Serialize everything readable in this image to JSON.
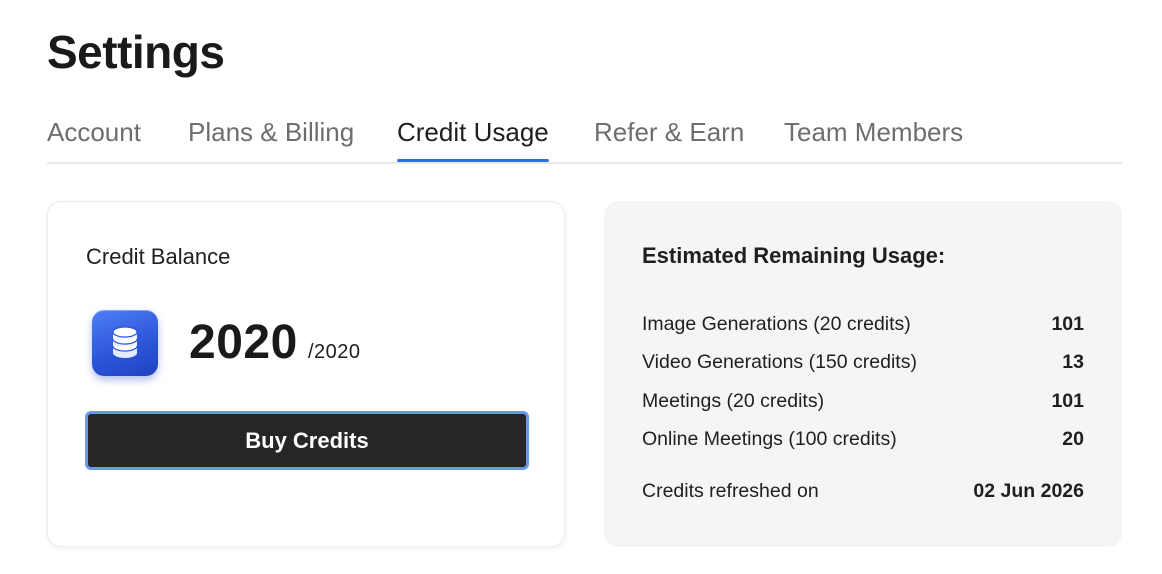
{
  "page": {
    "title": "Settings"
  },
  "tabs": [
    {
      "label": "Account",
      "active": false
    },
    {
      "label": "Plans & Billing",
      "active": false
    },
    {
      "label": "Credit Usage",
      "active": true
    },
    {
      "label": "Refer & Earn",
      "active": false
    },
    {
      "label": "Team Members",
      "active": false
    }
  ],
  "colors": {
    "accent": "#2f6fe0",
    "button_bg": "#262626",
    "button_border": "#6a97ef",
    "icon_gradient": "#2a54d8"
  },
  "balance": {
    "title": "Credit Balance",
    "icon": "coin-stack-icon",
    "current": "2020",
    "total": "/2020",
    "buy_label": "Buy Credits"
  },
  "usage": {
    "title": "Estimated Remaining Usage:",
    "rows": [
      {
        "label": "Image Generations (20 credits)",
        "value": "101"
      },
      {
        "label": "Video Generations (150 credits)",
        "value": "13"
      },
      {
        "label": "Meetings (20 credits)",
        "value": "101"
      },
      {
        "label": "Online Meetings (100 credits)",
        "value": "20"
      }
    ],
    "refreshed_label": "Credits refreshed on",
    "refreshed_value": "02 Jun 2026"
  }
}
